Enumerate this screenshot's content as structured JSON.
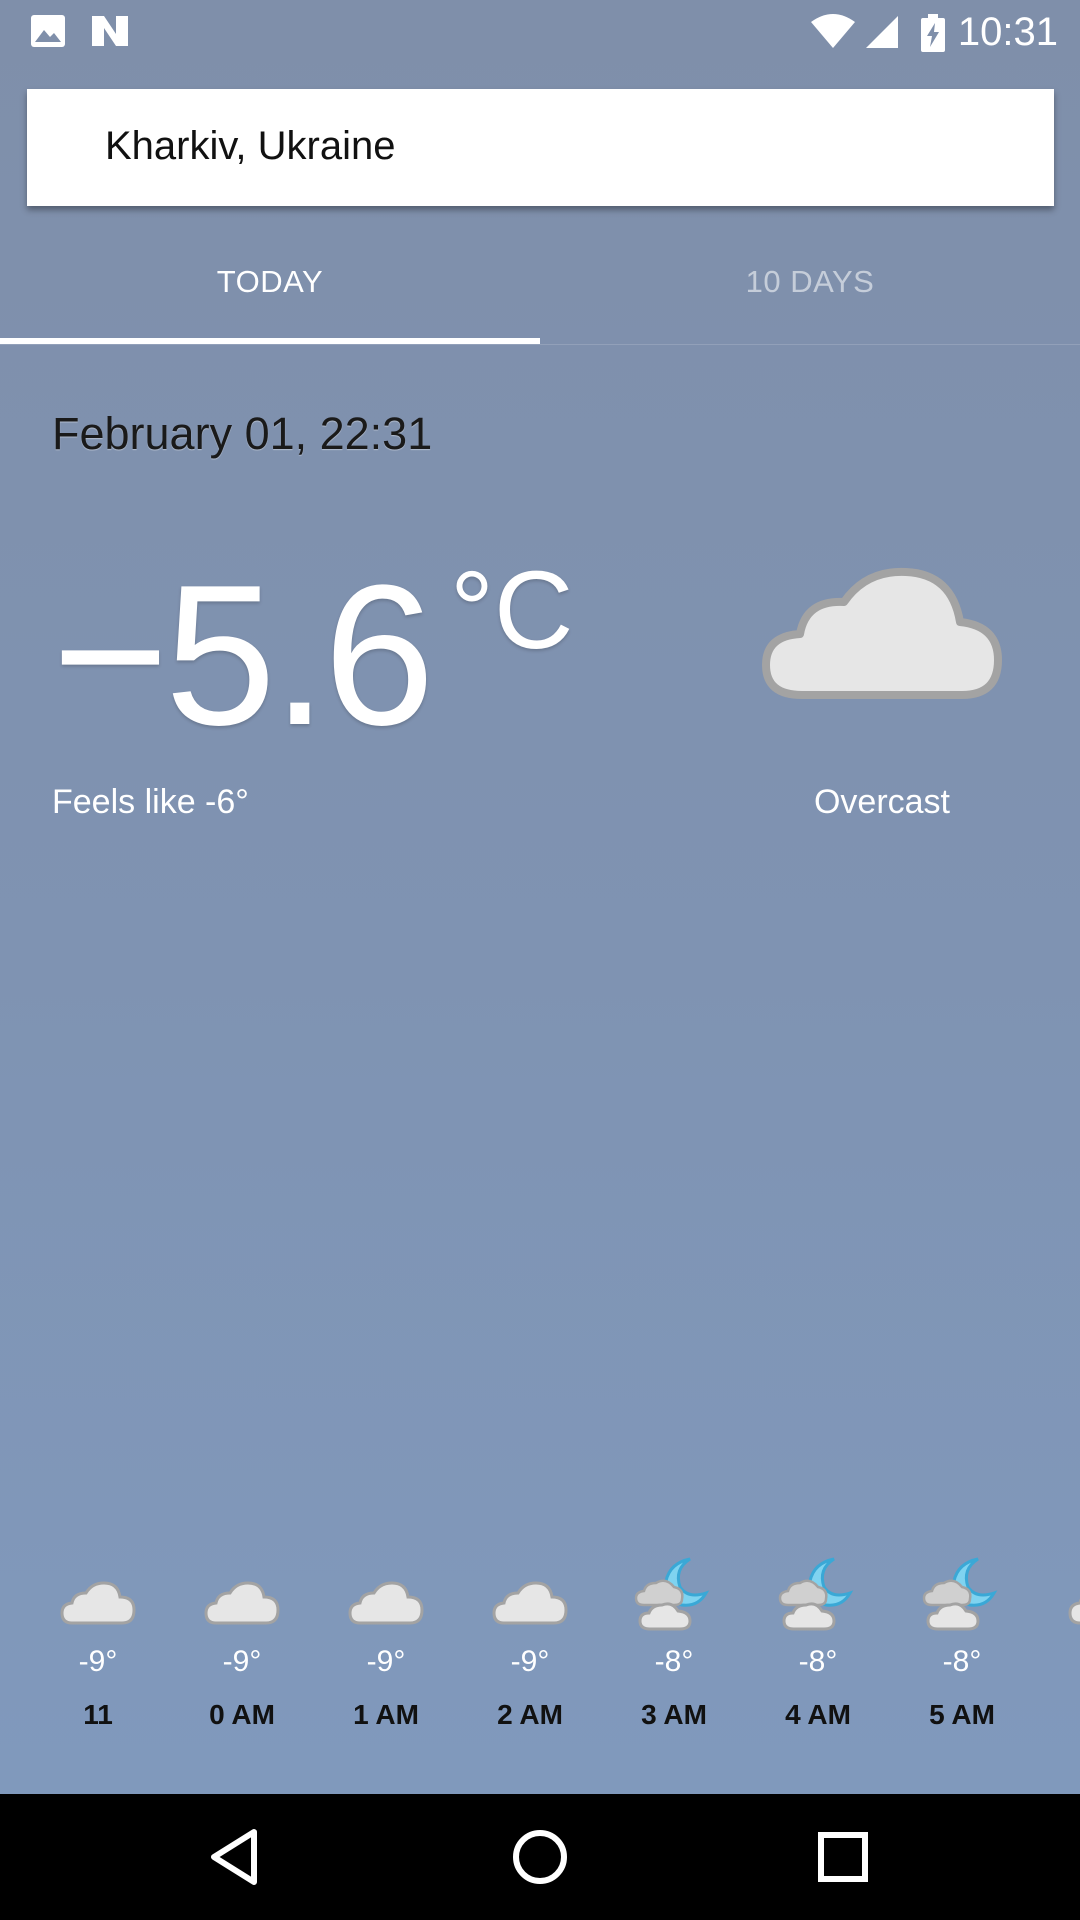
{
  "status_bar": {
    "time": "10:31",
    "icons": [
      "image-icon",
      "n-app-icon",
      "wifi-icon",
      "signal-icon",
      "battery-charging-icon"
    ]
  },
  "search": {
    "location": "Kharkiv, Ukraine"
  },
  "tabs": [
    {
      "label": "TODAY",
      "selected": true
    },
    {
      "label": "10 DAYS",
      "selected": false
    }
  ],
  "current": {
    "datetime": "February 01, 22:31",
    "temperature": "−5.6",
    "unit": "°C",
    "feels_like": "Feels like -6°",
    "condition": "Overcast",
    "condition_icon": "cloud-icon"
  },
  "hourly": [
    {
      "time": "11",
      "temp": "-9°",
      "icon": "cloud-icon"
    },
    {
      "time": "0 AM",
      "temp": "-9°",
      "icon": "cloud-icon"
    },
    {
      "time": "1 AM",
      "temp": "-9°",
      "icon": "cloud-icon"
    },
    {
      "time": "2 AM",
      "temp": "-9°",
      "icon": "cloud-icon"
    },
    {
      "time": "3 AM",
      "temp": "-8°",
      "icon": "cloudy-night-icon"
    },
    {
      "time": "4 AM",
      "temp": "-8°",
      "icon": "cloudy-night-icon"
    },
    {
      "time": "5 AM",
      "temp": "-8°",
      "icon": "cloudy-night-icon"
    }
  ],
  "nav": {
    "buttons": [
      "back-icon",
      "home-icon",
      "recents-icon"
    ]
  },
  "colors": {
    "background_top": "#7f8faa",
    "background_bottom": "#809abe",
    "moon": "#5bc3ea",
    "cloud_fill": "#e6e6e6",
    "cloud_stroke": "#a3a3a3"
  }
}
